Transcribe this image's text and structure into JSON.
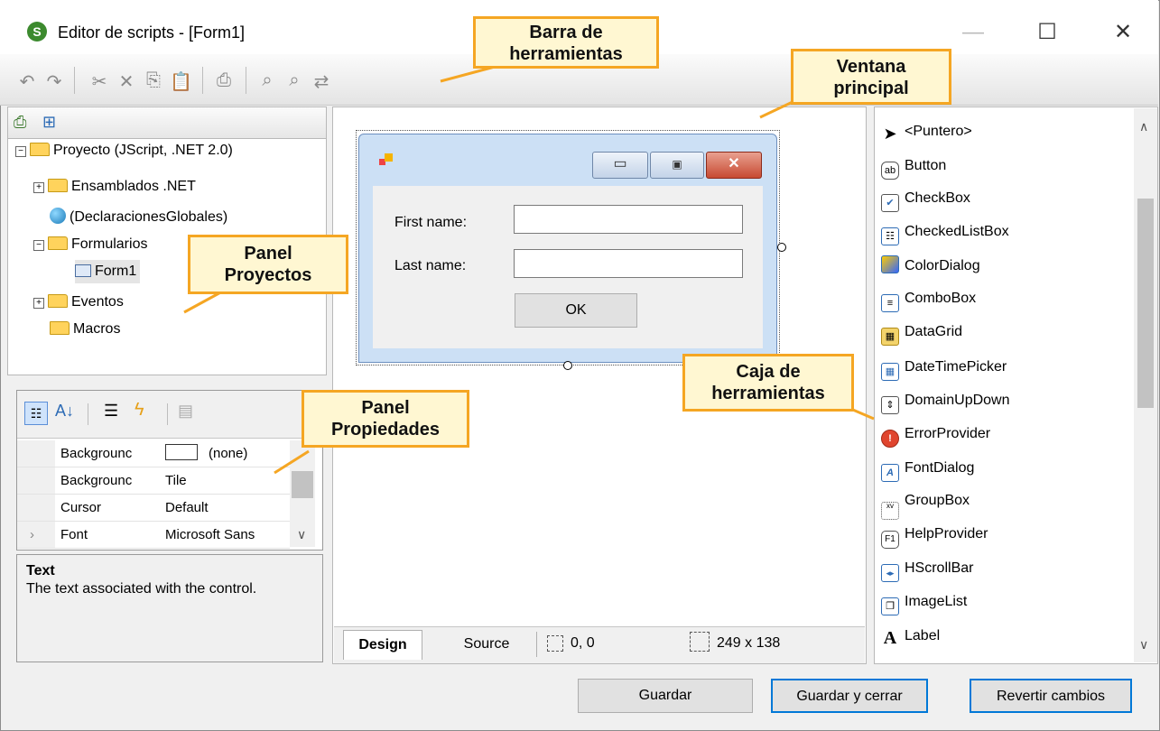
{
  "window": {
    "title": "Editor de scripts - [Form1]"
  },
  "colors": {
    "callout_border": "#f5a623",
    "callout_fill": "#fff7d2",
    "accent_blue": "#0078d7",
    "folder": "#ffd35c"
  },
  "toolbar_icons": [
    "undo-icon",
    "redo-icon",
    "cut-icon",
    "delete-icon",
    "copy-icon",
    "paste-icon",
    "print-icon",
    "find-icon",
    "find-next-icon",
    "replace-icon"
  ],
  "project_panel": {
    "items": [
      {
        "label": "Proyecto (JScript, .NET 2.0)"
      },
      {
        "label": "Ensamblados .NET"
      },
      {
        "label": "(DeclaracionesGlobales)"
      },
      {
        "label": "Formularios"
      },
      {
        "label": "Form1"
      },
      {
        "label": "Eventos"
      },
      {
        "label": "Macros"
      }
    ]
  },
  "properties_panel": {
    "rows": [
      {
        "name": "Backgrounc",
        "value": "(none)"
      },
      {
        "name": "Backgrounc",
        "value": "Tile"
      },
      {
        "name": "Cursor",
        "value": "Default"
      },
      {
        "name": "Font",
        "value": "Microsoft Sans"
      }
    ],
    "description_title": "Text",
    "description": "The text associated with the control."
  },
  "designer": {
    "form": {
      "first_name_label": "First name:",
      "last_name_label": "Last name:",
      "ok_label": "OK"
    },
    "tabs": {
      "design": "Design",
      "source": "Source"
    },
    "position": "0, 0",
    "size": "249 x 138"
  },
  "toolbox": {
    "items": [
      {
        "label": "<Puntero>",
        "icon": "pointer-icon"
      },
      {
        "label": "Button",
        "icon": "button-icon"
      },
      {
        "label": "CheckBox",
        "icon": "checkbox-icon"
      },
      {
        "label": "CheckedListBox",
        "icon": "checkedlistbox-icon"
      },
      {
        "label": "ColorDialog",
        "icon": "colordialog-icon"
      },
      {
        "label": "ComboBox",
        "icon": "combobox-icon"
      },
      {
        "label": "DataGrid",
        "icon": "datagrid-icon"
      },
      {
        "label": "DateTimePicker",
        "icon": "datetimepicker-icon"
      },
      {
        "label": "DomainUpDown",
        "icon": "domainupdown-icon"
      },
      {
        "label": "ErrorProvider",
        "icon": "errorprovider-icon"
      },
      {
        "label": "FontDialog",
        "icon": "fontdialog-icon"
      },
      {
        "label": "GroupBox",
        "icon": "groupbox-icon"
      },
      {
        "label": "HelpProvider",
        "icon": "helpprovider-icon"
      },
      {
        "label": "HScrollBar",
        "icon": "hscrollbar-icon"
      },
      {
        "label": "ImageList",
        "icon": "imagelist-icon"
      },
      {
        "label": "Label",
        "icon": "label-icon"
      }
    ]
  },
  "buttons": {
    "save": "Guardar",
    "save_close": "Guardar y cerrar",
    "revert": "Revertir cambios"
  },
  "callouts": {
    "toolbar_line1": "Barra de",
    "toolbar_line2": "herramientas",
    "main_line1": "Ventana",
    "main_line2": "principal",
    "projects_line1": "Panel",
    "projects_line2": "Proyectos",
    "props_line1": "Panel",
    "props_line2": "Propiedades",
    "toolbox_line1": "Caja de",
    "toolbox_line2": "herramientas"
  }
}
